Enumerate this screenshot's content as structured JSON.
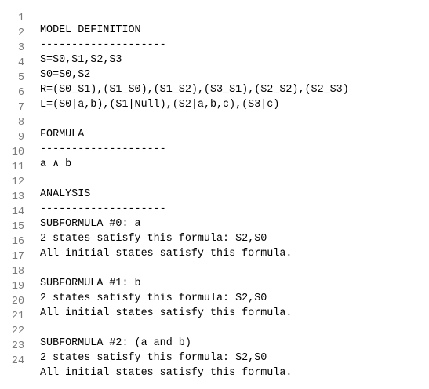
{
  "lines": [
    {
      "num": "1",
      "text": "MODEL DEFINITION"
    },
    {
      "num": "2",
      "text": "--------------------"
    },
    {
      "num": "3",
      "text": "S=S0,S1,S2,S3"
    },
    {
      "num": "4",
      "text": "S0=S0,S2"
    },
    {
      "num": "5",
      "text": "R=(S0_S1),(S1_S0),(S1_S2),(S3_S1),(S2_S2),(S2_S3)"
    },
    {
      "num": "6",
      "text": "L=(S0|a,b),(S1|Null),(S2|a,b,c),(S3|c)"
    },
    {
      "num": "7",
      "text": ""
    },
    {
      "num": "8",
      "text": "FORMULA"
    },
    {
      "num": "9",
      "text": "--------------------"
    },
    {
      "num": "10",
      "text": "a ∧ b"
    },
    {
      "num": "11",
      "text": ""
    },
    {
      "num": "12",
      "text": "ANALYSIS"
    },
    {
      "num": "13",
      "text": "--------------------"
    },
    {
      "num": "14",
      "text": "SUBFORMULA #0: a"
    },
    {
      "num": "15",
      "text": "2 states satisfy this formula: S2,S0"
    },
    {
      "num": "16",
      "text": "All initial states satisfy this formula."
    },
    {
      "num": "17",
      "text": ""
    },
    {
      "num": "18",
      "text": "SUBFORMULA #1: b"
    },
    {
      "num": "19",
      "text": "2 states satisfy this formula: S2,S0"
    },
    {
      "num": "20",
      "text": "All initial states satisfy this formula."
    },
    {
      "num": "21",
      "text": ""
    },
    {
      "num": "22",
      "text": "SUBFORMULA #2: (a and b)"
    },
    {
      "num": "23",
      "text": "2 states satisfy this formula: S2,S0"
    },
    {
      "num": "24",
      "text": "All initial states satisfy this formula."
    }
  ]
}
